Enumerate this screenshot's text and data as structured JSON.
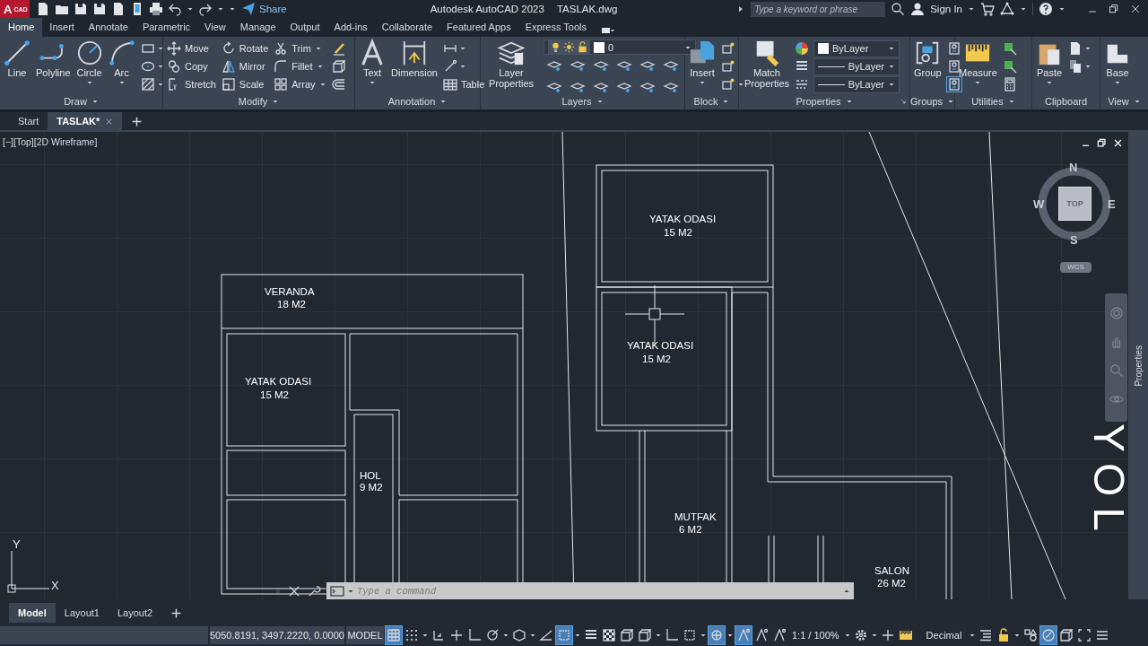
{
  "title_bar": {
    "app_badge": {
      "letter": "A",
      "text": "CAD"
    },
    "share": "Share",
    "title": "Autodesk AutoCAD 2023",
    "file_name": "TASLAK.dwg",
    "search": {
      "placeholder": "Type a keyword or phrase"
    },
    "sign_in": "Sign In"
  },
  "ribbon_tabs": [
    {
      "label": "Home",
      "selected": true
    },
    {
      "label": "Insert",
      "selected": false
    },
    {
      "label": "Annotate",
      "selected": false
    },
    {
      "label": "Parametric",
      "selected": false
    },
    {
      "label": "View",
      "selected": false
    },
    {
      "label": "Manage",
      "selected": false
    },
    {
      "label": "Output",
      "selected": false
    },
    {
      "label": "Add-ins",
      "selected": false
    },
    {
      "label": "Collaborate",
      "selected": false
    },
    {
      "label": "Featured Apps",
      "selected": false
    },
    {
      "label": "Express Tools",
      "selected": false
    }
  ],
  "ribbon_panels": [
    {
      "title": "Draw",
      "menu": true,
      "tools": [
        {
          "kind": "large",
          "label": "Line"
        },
        {
          "kind": "large",
          "label": "Polyline"
        },
        {
          "kind": "large",
          "label": "Circle",
          "menu": true
        },
        {
          "kind": "large",
          "label": "Arc",
          "menu": true
        },
        {
          "kind": "icon",
          "menu": true
        },
        {
          "kind": "icon",
          "menu": true
        },
        {
          "kind": "icon",
          "menu": true
        }
      ]
    },
    {
      "title": "Modify",
      "menu": true,
      "tools": [
        {
          "kind": "small",
          "label": "Move"
        },
        {
          "kind": "small",
          "label": "Copy"
        },
        {
          "kind": "small",
          "label": "Stretch"
        },
        {
          "kind": "small",
          "label": "Rotate"
        },
        {
          "kind": "small",
          "label": "Mirror"
        },
        {
          "kind": "small",
          "label": "Scale"
        },
        {
          "kind": "small",
          "label": "Trim",
          "menu": true
        },
        {
          "kind": "small",
          "label": "Fillet",
          "menu": true
        },
        {
          "kind": "small",
          "label": "Array",
          "menu": true
        },
        {
          "kind": "icon"
        },
        {
          "kind": "icon"
        },
        {
          "kind": "icon"
        }
      ]
    },
    {
      "title": "Annotation",
      "menu": true,
      "tools": [
        {
          "kind": "large",
          "label": "Text",
          "menu": true
        },
        {
          "kind": "large",
          "label": "Dimension"
        },
        {
          "kind": "icon",
          "menu": true
        },
        {
          "kind": "icon",
          "menu": true
        },
        {
          "kind": "small",
          "label": "Table"
        }
      ]
    },
    {
      "title": "Layers",
      "menu": true,
      "tools": [
        {
          "kind": "large",
          "label": "Layer Properties"
        },
        {
          "kind": "layer_combo",
          "value": "0",
          "swatch": true
        },
        {
          "kind": "icon"
        },
        {
          "kind": "icon"
        },
        {
          "kind": "icon"
        },
        {
          "kind": "icon"
        },
        {
          "kind": "icon"
        },
        {
          "kind": "icon"
        },
        {
          "kind": "icon"
        },
        {
          "kind": "icon"
        },
        {
          "kind": "icon"
        },
        {
          "kind": "icon"
        },
        {
          "kind": "icon"
        },
        {
          "kind": "icon"
        }
      ]
    },
    {
      "title": "Block",
      "menu": true,
      "tools": [
        {
          "kind": "large",
          "label": "Insert",
          "menu": true
        },
        {
          "kind": "icon"
        },
        {
          "kind": "icon"
        },
        {
          "kind": "icon",
          "menu": true
        }
      ]
    },
    {
      "title": "Properties",
      "menu": true,
      "launcher": true,
      "tools": [
        {
          "kind": "large",
          "label": "Match Properties"
        },
        {
          "kind": "property_combo",
          "value": "ByLayer",
          "swatch": true
        },
        {
          "kind": "property_combo",
          "value": "ByLayer",
          "line": true
        },
        {
          "kind": "property_combo",
          "value": "ByLayer",
          "line": true
        }
      ]
    },
    {
      "title": "Groups",
      "menu": true,
      "tools": [
        {
          "kind": "large",
          "label": "Group"
        },
        {
          "kind": "icon",
          "on": false
        },
        {
          "kind": "icon",
          "on": false
        },
        {
          "kind": "icon",
          "on": true
        }
      ]
    },
    {
      "title": "Utilities",
      "menu": true,
      "tools": [
        {
          "kind": "large",
          "label": "Measure",
          "menu": true
        },
        {
          "kind": "icon"
        },
        {
          "kind": "icon"
        },
        {
          "kind": "icon"
        }
      ]
    },
    {
      "title": "Clipboard",
      "tools": [
        {
          "kind": "large",
          "label": "Paste",
          "menu": true
        },
        {
          "kind": "icon",
          "menu": true
        },
        {
          "kind": "icon",
          "menu": true
        }
      ]
    },
    {
      "title": "View",
      "menu": true,
      "tools": [
        {
          "kind": "large",
          "label": "Base",
          "menu": true
        }
      ]
    }
  ],
  "file_tabs": [
    {
      "label": "Start",
      "selected": false
    },
    {
      "label": "TASLAK*",
      "selected": true,
      "closable": true
    }
  ],
  "viewport": {
    "label": "[−][Top][2D Wireframe]"
  },
  "drawing": {
    "labels": [
      {
        "name": "VERANDA",
        "area": "18 M2"
      },
      {
        "name": "YATAK ODASI",
        "area": "15 M2"
      },
      {
        "name": "HOL",
        "area": "9 M2"
      },
      {
        "name": "YATAK ODASI",
        "area": "15 M2"
      },
      {
        "name": "YATAK ODASI",
        "area": "15 M2"
      },
      {
        "name": "MUTFAK",
        "area": "6 M2"
      },
      {
        "name": "SALON",
        "area": "26 M2"
      }
    ],
    "road_label": "YOL"
  },
  "viewcube": {
    "face": "TOP",
    "north": "N",
    "south": "S",
    "east": "E",
    "west": "W",
    "ucs_menu": "WCS"
  },
  "ucs": {
    "y_label": "Y",
    "x_label": "X"
  },
  "command_line": {
    "placeholder": "Type a command"
  },
  "properties_palette": {
    "title": "Properties"
  },
  "layout_tabs": [
    {
      "label": "Model",
      "selected": true
    },
    {
      "label": "Layout1",
      "selected": false
    },
    {
      "label": "Layout2",
      "selected": false
    }
  ],
  "status_bar": {
    "coordinates": "5050.8191, 3497.2220, 0.0000",
    "space": "MODEL",
    "items": [
      {
        "kind": "toggle",
        "on": true
      },
      {
        "kind": "toggle",
        "on": false
      },
      {
        "kind": "caret"
      },
      {
        "kind": "toggle",
        "on": false
      },
      {
        "kind": "toggle",
        "on": false
      },
      {
        "kind": "toggle",
        "on": false
      },
      {
        "kind": "toggle",
        "on": false
      },
      {
        "kind": "caret"
      },
      {
        "kind": "toggle",
        "on": false
      },
      {
        "kind": "caret"
      },
      {
        "kind": "toggle",
        "on": false
      },
      {
        "kind": "toggle",
        "on": true
      },
      {
        "kind": "caret"
      },
      {
        "kind": "toggle",
        "on": false
      },
      {
        "kind": "toggle",
        "on": false
      },
      {
        "kind": "toggle",
        "on": false
      },
      {
        "kind": "toggle",
        "on": false
      },
      {
        "kind": "caret"
      },
      {
        "kind": "toggle",
        "on": false
      },
      {
        "kind": "toggle",
        "on": false
      },
      {
        "kind": "caret"
      },
      {
        "kind": "toggle",
        "on": true
      },
      {
        "kind": "caret"
      },
      {
        "kind": "toggle",
        "on": true
      },
      {
        "kind": "toggle",
        "on": false
      },
      {
        "kind": "toggle",
        "on": false
      },
      {
        "kind": "scale",
        "text": "1:1 / 100%"
      },
      {
        "kind": "caret"
      },
      {
        "kind": "toggle",
        "on": false
      },
      {
        "kind": "caret"
      },
      {
        "kind": "toggle",
        "on": false
      },
      {
        "kind": "toggle",
        "on": false
      },
      {
        "kind": "units",
        "text": "Decimal"
      },
      {
        "kind": "caret"
      },
      {
        "kind": "toggle",
        "on": false
      },
      {
        "kind": "toggle",
        "on": false
      },
      {
        "kind": "caret"
      },
      {
        "kind": "toggle",
        "on": false
      },
      {
        "kind": "toggle",
        "on": true
      },
      {
        "kind": "toggle",
        "on": false
      },
      {
        "kind": "toggle",
        "on": false
      },
      {
        "kind": "toggle",
        "on": false
      }
    ]
  }
}
